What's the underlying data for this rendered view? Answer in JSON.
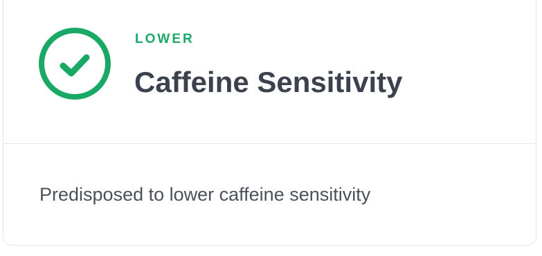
{
  "result": {
    "level_label": "LOWER",
    "trait_name": "Caffeine Sensitivity",
    "description": "Predisposed to lower caffeine sensitivity",
    "status_icon": "check-circle-icon",
    "accent_color": "#1aa866"
  }
}
